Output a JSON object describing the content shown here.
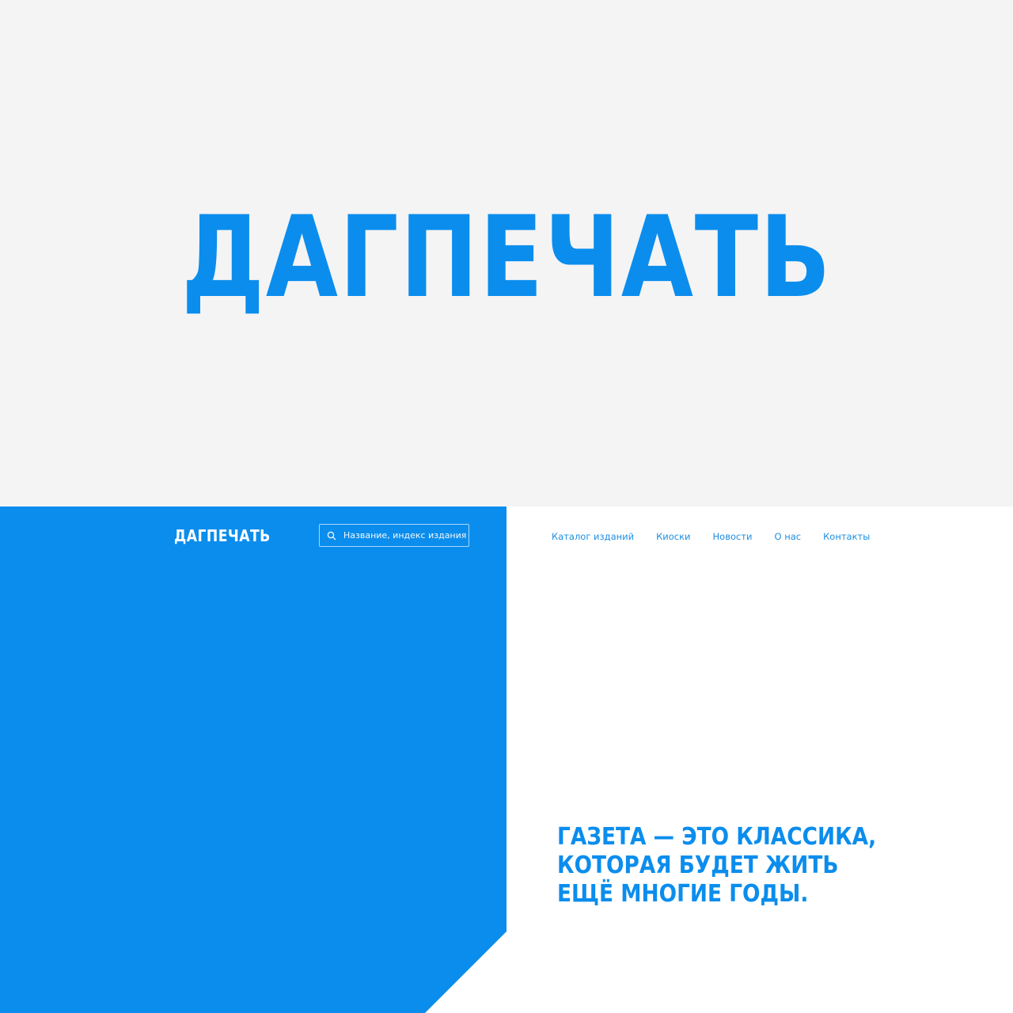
{
  "hero": {
    "logo_text": "ДАГПЕЧАТЬ"
  },
  "header": {
    "logo_text": "ДАГПЕЧАТЬ",
    "search": {
      "placeholder": "Название, индекс издания",
      "icon": "search-icon"
    },
    "nav": [
      {
        "label": "Каталог изданий"
      },
      {
        "label": "Киоски"
      },
      {
        "label": "Новости"
      },
      {
        "label": "О нас"
      },
      {
        "label": "Контакты"
      }
    ]
  },
  "tagline": {
    "lines": [
      "ГАЗЕТА — ЭТО КЛАССИКА,",
      "КОТОРАЯ БУДЕТ ЖИТЬ",
      "ЕЩЁ МНОГИЕ ГОДЫ."
    ]
  },
  "colors": {
    "brand_blue": "#0b8ded",
    "hero_background": "#f4f4f5",
    "nav_text": "#1c8fe3",
    "page_background": "#ffffff"
  }
}
